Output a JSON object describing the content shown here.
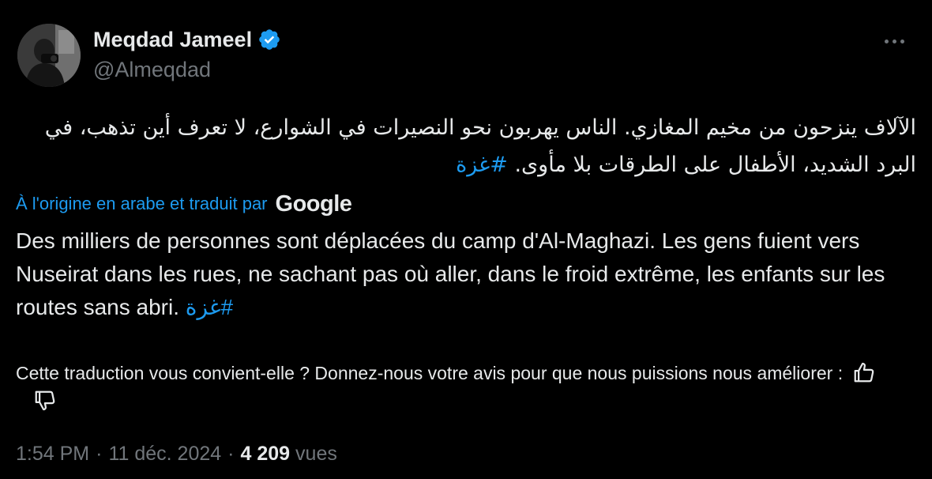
{
  "author": {
    "display_name": "Meqdad Jameel",
    "handle": "@Almeqdad",
    "verified": true
  },
  "tweet": {
    "original_text": "الآلاف ينزحون من مخيم المغازي. الناس يهربون نحو النصيرات في الشوارع، لا تعرف أين تذهب، في البرد الشديد، الأطفال على الطرقات بلا مأوى.",
    "original_hashtag": "#غزة",
    "translation_attribution": "À l'origine en arabe et traduit par",
    "translation_provider": "Google",
    "translated_text": "Des milliers de personnes sont déplacées du camp d'Al-Maghazi. Les gens fuient vers Nuseirat dans les rues, ne sachant pas où aller, dans le froid extrême, les enfants sur les routes sans abri. ",
    "translated_hashtag": "#غزة",
    "feedback_prompt": "Cette traduction vous convient-elle ? Donnez-nous votre avis pour que nous puissions nous améliorer :"
  },
  "meta": {
    "time": "1:54 PM",
    "separator": "·",
    "date": "11 déc. 2024",
    "views_count": "4 209",
    "views_label": "vues"
  },
  "icons": {
    "more": "more-options-icon",
    "verified": "verified-badge-icon",
    "thumbs_up": "thumbs-up-icon",
    "thumbs_down": "thumbs-down-icon"
  },
  "colors": {
    "background": "#000000",
    "text_primary": "#e7e9ea",
    "text_secondary": "#71767b",
    "accent": "#1d9bf0"
  }
}
